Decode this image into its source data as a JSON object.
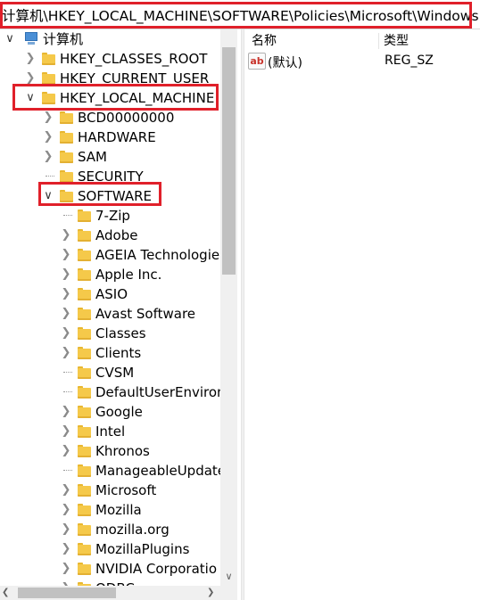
{
  "address_bar": {
    "path": "计算机\\HKEY_LOCAL_MACHINE\\SOFTWARE\\Policies\\Microsoft\\Windows"
  },
  "tree": {
    "root_label": "计算机",
    "hives": [
      {
        "label": "HKEY_CLASSES_ROOT",
        "expanded": false
      },
      {
        "label": "HKEY_CURRENT_USER",
        "expanded": false
      },
      {
        "label": "HKEY_LOCAL_MACHINE",
        "expanded": true
      }
    ],
    "hklm_children": [
      {
        "label": "BCD00000000",
        "has_children": true
      },
      {
        "label": "HARDWARE",
        "has_children": true
      },
      {
        "label": "SAM",
        "has_children": true
      },
      {
        "label": "SECURITY",
        "has_children": false
      },
      {
        "label": "SOFTWARE",
        "has_children": true,
        "expanded": true
      }
    ],
    "software_children": [
      {
        "label": "7-Zip",
        "has_children": false
      },
      {
        "label": "Adobe",
        "has_children": true
      },
      {
        "label": "AGEIA Technologie",
        "has_children": true
      },
      {
        "label": "Apple Inc.",
        "has_children": true
      },
      {
        "label": "ASIO",
        "has_children": true
      },
      {
        "label": "Avast Software",
        "has_children": true
      },
      {
        "label": "Classes",
        "has_children": true
      },
      {
        "label": "Clients",
        "has_children": true
      },
      {
        "label": "CVSM",
        "has_children": false
      },
      {
        "label": "DefaultUserEnviron",
        "has_children": false
      },
      {
        "label": "Google",
        "has_children": true
      },
      {
        "label": "Intel",
        "has_children": true
      },
      {
        "label": "Khronos",
        "has_children": true
      },
      {
        "label": "ManageableUpdate",
        "has_children": false
      },
      {
        "label": "Microsoft",
        "has_children": true
      },
      {
        "label": "Mozilla",
        "has_children": true
      },
      {
        "label": "mozilla.org",
        "has_children": true
      },
      {
        "label": "MozillaPlugins",
        "has_children": true
      },
      {
        "label": "NVIDIA Corporatio",
        "has_children": true
      },
      {
        "label": "ODBC",
        "has_children": true
      }
    ]
  },
  "list": {
    "columns": {
      "name": "名称",
      "type": "类型"
    },
    "rows": [
      {
        "icon": "string-value-icon",
        "icon_text": "ab",
        "name": "(默认)",
        "type": "REG_SZ"
      }
    ]
  },
  "colors": {
    "highlight": "#e0202a",
    "folder": "#f5c94a",
    "scrollbar_thumb": "#c1c1c1"
  }
}
